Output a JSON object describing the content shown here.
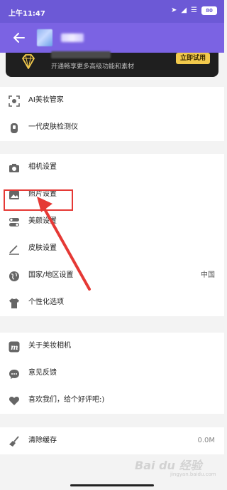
{
  "status_bar": {
    "time": "上午11:47",
    "battery": "80"
  },
  "promo": {
    "description": "开通畅享更多高级功能和素材",
    "trial_button": "立即试用"
  },
  "settings": {
    "group1": [
      {
        "label": "AI美妆管家",
        "icon": "ai-scan-icon"
      },
      {
        "label": "一代皮肤检测仪",
        "icon": "skin-detector-icon"
      }
    ],
    "group2": [
      {
        "label": "相机设置",
        "icon": "camera-icon"
      },
      {
        "label": "照片设置",
        "icon": "photo-icon"
      },
      {
        "label": "美颜设置",
        "icon": "toggle-icon"
      },
      {
        "label": "皮肤设置",
        "icon": "pen-icon"
      },
      {
        "label": "国家/地区设置",
        "icon": "globe-icon",
        "value": "中国"
      },
      {
        "label": "个性化选项",
        "icon": "tshirt-icon"
      }
    ],
    "group3": [
      {
        "label": "关于美妆相机",
        "icon": "app-logo-icon"
      },
      {
        "label": "意见反馈",
        "icon": "chat-icon"
      },
      {
        "label": "喜欢我们，给个好评吧:)",
        "icon": "heart-icon"
      }
    ],
    "group4": [
      {
        "label": "清除缓存",
        "icon": "broom-icon",
        "value": "0.0M"
      }
    ]
  },
  "watermark": {
    "main": "Bai du 经验",
    "sub": "jingyan.baidu.com"
  },
  "colors": {
    "header": "#7b63e3",
    "highlight": "#e53935",
    "trial": "#f2c94c"
  }
}
